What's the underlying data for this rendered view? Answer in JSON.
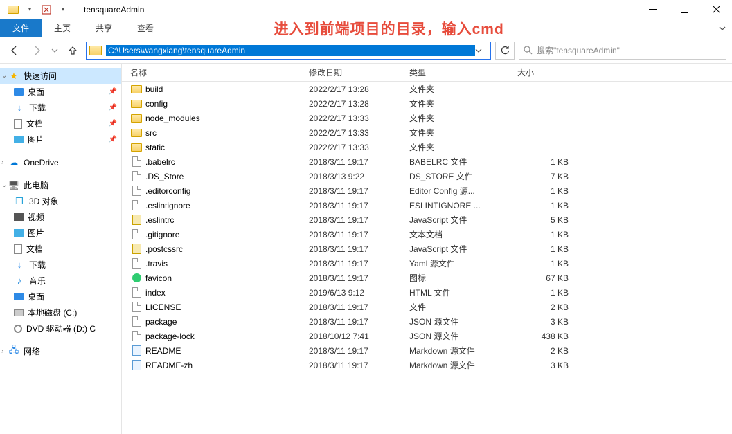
{
  "window": {
    "title": "tensquareAdmin"
  },
  "ribbon": {
    "tabs": [
      "文件",
      "主页",
      "共享",
      "查看"
    ],
    "overlay": "进入到前端项目的目录，输入cmd"
  },
  "address": {
    "path": "C:\\Users\\wangxiang\\tensquareAdmin",
    "search_placeholder": "搜索\"tensquareAdmin\""
  },
  "nav": {
    "groups": [
      {
        "label": "快速访问",
        "icon": "star",
        "header": true,
        "expanded": true,
        "selected": true
      },
      {
        "label": "桌面",
        "icon": "desktop",
        "pinned": true
      },
      {
        "label": "下载",
        "icon": "dl",
        "pinned": true
      },
      {
        "label": "文档",
        "icon": "doc",
        "pinned": true
      },
      {
        "label": "图片",
        "icon": "pic",
        "pinned": true
      },
      {
        "spacer": true
      },
      {
        "label": "OneDrive",
        "icon": "cloud",
        "header": true
      },
      {
        "spacer": true
      },
      {
        "label": "此电脑",
        "icon": "pc",
        "header": true,
        "expanded": true
      },
      {
        "label": "3D 对象",
        "icon": "cube"
      },
      {
        "label": "视频",
        "icon": "vid"
      },
      {
        "label": "图片",
        "icon": "pic"
      },
      {
        "label": "文档",
        "icon": "doc"
      },
      {
        "label": "下载",
        "icon": "dl"
      },
      {
        "label": "音乐",
        "icon": "music"
      },
      {
        "label": "桌面",
        "icon": "desktop"
      },
      {
        "label": "本地磁盘 (C:)",
        "icon": "disk"
      },
      {
        "label": "DVD 驱动器 (D:) C",
        "icon": "dvd"
      },
      {
        "spacer": true
      },
      {
        "label": "网络",
        "icon": "net",
        "header": true
      }
    ]
  },
  "columns": {
    "name": "名称",
    "date": "修改日期",
    "type": "类型",
    "size": "大小"
  },
  "files": [
    {
      "name": "build",
      "date": "2022/2/17 13:28",
      "type": "文件夹",
      "size": "",
      "icon": "folder"
    },
    {
      "name": "config",
      "date": "2022/2/17 13:28",
      "type": "文件夹",
      "size": "",
      "icon": "folder"
    },
    {
      "name": "node_modules",
      "date": "2022/2/17 13:33",
      "type": "文件夹",
      "size": "",
      "icon": "folder"
    },
    {
      "name": "src",
      "date": "2022/2/17 13:33",
      "type": "文件夹",
      "size": "",
      "icon": "folder"
    },
    {
      "name": "static",
      "date": "2022/2/17 13:33",
      "type": "文件夹",
      "size": "",
      "icon": "folder"
    },
    {
      "name": ".babelrc",
      "date": "2018/3/11 19:17",
      "type": "BABELRC 文件",
      "size": "1 KB",
      "icon": "file"
    },
    {
      "name": ".DS_Store",
      "date": "2018/3/13 9:22",
      "type": "DS_STORE 文件",
      "size": "7 KB",
      "icon": "file"
    },
    {
      "name": ".editorconfig",
      "date": "2018/3/11 19:17",
      "type": "Editor Config 源...",
      "size": "1 KB",
      "icon": "file"
    },
    {
      "name": ".eslintignore",
      "date": "2018/3/11 19:17",
      "type": "ESLINTIGNORE ...",
      "size": "1 KB",
      "icon": "file"
    },
    {
      "name": ".eslintrc",
      "date": "2018/3/11 19:17",
      "type": "JavaScript 文件",
      "size": "5 KB",
      "icon": "js"
    },
    {
      "name": ".gitignore",
      "date": "2018/3/11 19:17",
      "type": "文本文档",
      "size": "1 KB",
      "icon": "file"
    },
    {
      "name": ".postcssrc",
      "date": "2018/3/11 19:17",
      "type": "JavaScript 文件",
      "size": "1 KB",
      "icon": "js"
    },
    {
      "name": ".travis",
      "date": "2018/3/11 19:17",
      "type": "Yaml 源文件",
      "size": "1 KB",
      "icon": "file"
    },
    {
      "name": "favicon",
      "date": "2018/3/11 19:17",
      "type": "图标",
      "size": "67 KB",
      "icon": "fav"
    },
    {
      "name": "index",
      "date": "2019/6/13 9:12",
      "type": "HTML 文件",
      "size": "1 KB",
      "icon": "file"
    },
    {
      "name": "LICENSE",
      "date": "2018/3/11 19:17",
      "type": "文件",
      "size": "2 KB",
      "icon": "file"
    },
    {
      "name": "package",
      "date": "2018/3/11 19:17",
      "type": "JSON 源文件",
      "size": "3 KB",
      "icon": "file"
    },
    {
      "name": "package-lock",
      "date": "2018/10/12 7:41",
      "type": "JSON 源文件",
      "size": "438 KB",
      "icon": "file"
    },
    {
      "name": "README",
      "date": "2018/3/11 19:17",
      "type": "Markdown 源文件",
      "size": "2 KB",
      "icon": "md"
    },
    {
      "name": "README-zh",
      "date": "2018/3/11 19:17",
      "type": "Markdown 源文件",
      "size": "3 KB",
      "icon": "md"
    }
  ]
}
